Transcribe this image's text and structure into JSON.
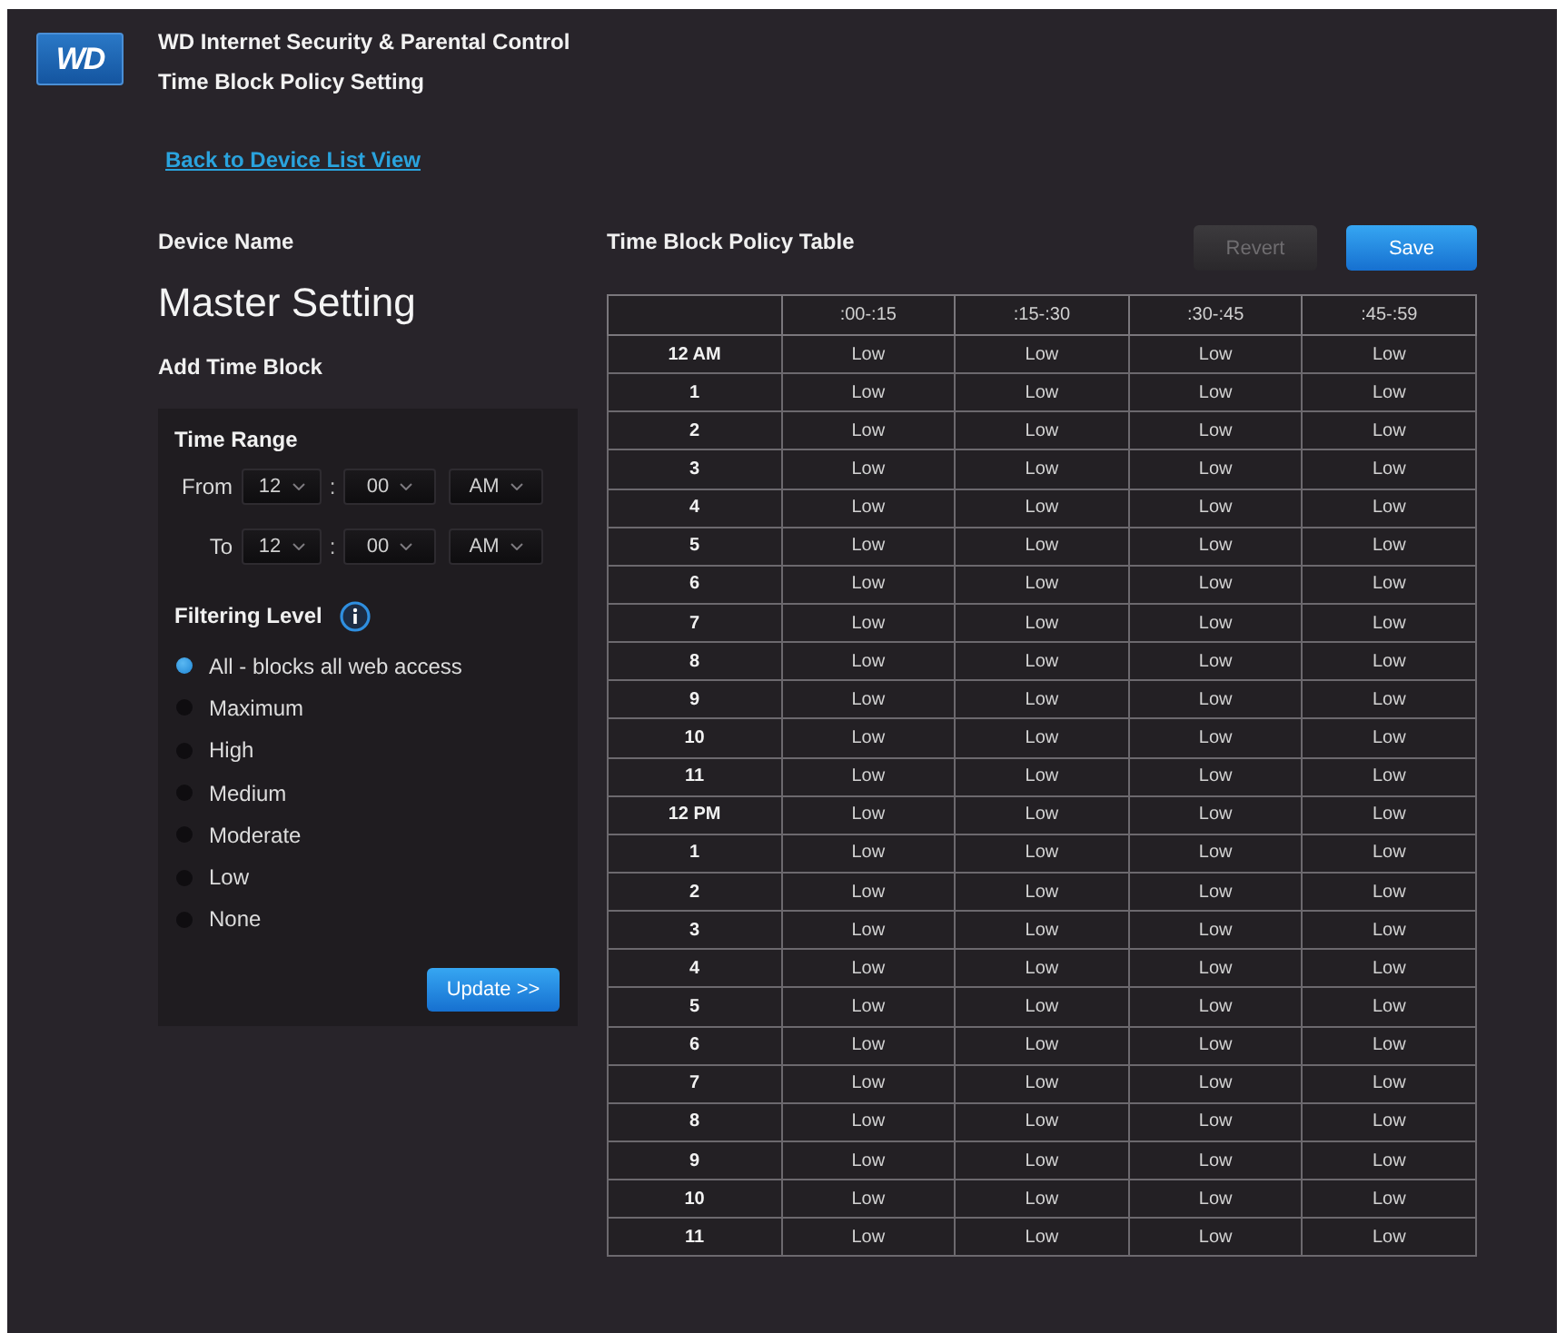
{
  "header": {
    "logo": "WD",
    "title": "WD Internet Security & Parental Control",
    "subtitle": "Time Block Policy Setting"
  },
  "back_link": "Back to Device List View",
  "device": {
    "label": "Device Name",
    "name": "Master Setting"
  },
  "add_time_block": {
    "title": "Add Time Block",
    "time_range": {
      "title": "Time Range",
      "rows": [
        {
          "label": "From",
          "hour": "12",
          "separator": ":",
          "minute": "00",
          "period": "AM"
        },
        {
          "label": "To",
          "hour": "12",
          "separator": ":",
          "minute": "00",
          "period": "AM"
        }
      ]
    },
    "filtering": {
      "title": "Filtering Level",
      "options": [
        {
          "label": "All - blocks all web access",
          "selected": true
        },
        {
          "label": "Maximum",
          "selected": false
        },
        {
          "label": "High",
          "selected": false
        },
        {
          "label": "Medium",
          "selected": false
        },
        {
          "label": "Moderate",
          "selected": false
        },
        {
          "label": "Low",
          "selected": false
        },
        {
          "label": "None",
          "selected": false
        }
      ]
    },
    "update_button": "Update >>"
  },
  "policy_table": {
    "title": "Time Block Policy Table",
    "buttons": [
      {
        "label": "Revert",
        "disabled": true
      },
      {
        "label": "Save",
        "disabled": false
      }
    ],
    "columns": [
      ":00-:15",
      ":15-:30",
      ":30-:45",
      ":45-:59"
    ],
    "rows": [
      {
        "hour": "12 AM",
        "cells": [
          "Low",
          "Low",
          "Low",
          "Low"
        ]
      },
      {
        "hour": "1",
        "cells": [
          "Low",
          "Low",
          "Low",
          "Low"
        ]
      },
      {
        "hour": "2",
        "cells": [
          "Low",
          "Low",
          "Low",
          "Low"
        ]
      },
      {
        "hour": "3",
        "cells": [
          "Low",
          "Low",
          "Low",
          "Low"
        ]
      },
      {
        "hour": "4",
        "cells": [
          "Low",
          "Low",
          "Low",
          "Low"
        ]
      },
      {
        "hour": "5",
        "cells": [
          "Low",
          "Low",
          "Low",
          "Low"
        ]
      },
      {
        "hour": "6",
        "cells": [
          "Low",
          "Low",
          "Low",
          "Low"
        ]
      },
      {
        "hour": "7",
        "cells": [
          "Low",
          "Low",
          "Low",
          "Low"
        ]
      },
      {
        "hour": "8",
        "cells": [
          "Low",
          "Low",
          "Low",
          "Low"
        ]
      },
      {
        "hour": "9",
        "cells": [
          "Low",
          "Low",
          "Low",
          "Low"
        ]
      },
      {
        "hour": "10",
        "cells": [
          "Low",
          "Low",
          "Low",
          "Low"
        ]
      },
      {
        "hour": "11",
        "cells": [
          "Low",
          "Low",
          "Low",
          "Low"
        ]
      },
      {
        "hour": "12 PM",
        "cells": [
          "Low",
          "Low",
          "Low",
          "Low"
        ]
      },
      {
        "hour": "1",
        "cells": [
          "Low",
          "Low",
          "Low",
          "Low"
        ]
      },
      {
        "hour": "2",
        "cells": [
          "Low",
          "Low",
          "Low",
          "Low"
        ]
      },
      {
        "hour": "3",
        "cells": [
          "Low",
          "Low",
          "Low",
          "Low"
        ]
      },
      {
        "hour": "4",
        "cells": [
          "Low",
          "Low",
          "Low",
          "Low"
        ]
      },
      {
        "hour": "5",
        "cells": [
          "Low",
          "Low",
          "Low",
          "Low"
        ]
      },
      {
        "hour": "6",
        "cells": [
          "Low",
          "Low",
          "Low",
          "Low"
        ]
      },
      {
        "hour": "7",
        "cells": [
          "Low",
          "Low",
          "Low",
          "Low"
        ]
      },
      {
        "hour": "8",
        "cells": [
          "Low",
          "Low",
          "Low",
          "Low"
        ]
      },
      {
        "hour": "9",
        "cells": [
          "Low",
          "Low",
          "Low",
          "Low"
        ]
      },
      {
        "hour": "10",
        "cells": [
          "Low",
          "Low",
          "Low",
          "Low"
        ]
      },
      {
        "hour": "11",
        "cells": [
          "Low",
          "Low",
          "Low",
          "Low"
        ]
      }
    ]
  }
}
